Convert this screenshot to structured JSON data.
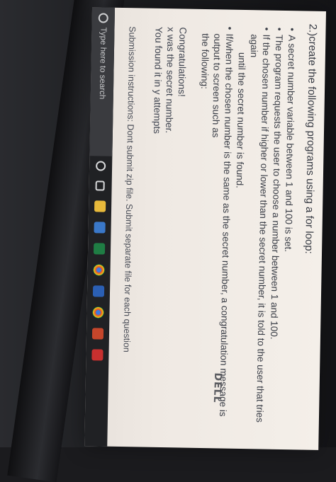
{
  "question": {
    "title": "2.)create the following programs using a for loop:",
    "bullets": [
      "A secret number variable between 1 and 100 is set.",
      "The program requests the user to choose a number between 1 and 100.",
      "If the chosen number if higher or lower than the secret number, it is told to the user that tries again",
      "until the secret number is found.",
      "If/when the chosen number is the same as the secret number, a congratulation message is output to screen such as",
      "the following:"
    ],
    "message_lines": [
      "Congratulations!",
      "x was the secret number.",
      "You found it in y attempts"
    ],
    "submission": "Submission instructions: Dont submit zip file. Submit separate file for each question"
  },
  "taskbar": {
    "search_placeholder": "Type here to search",
    "icons": [
      "cortana-icon",
      "task-view-icon",
      "file-explorer-icon",
      "store-icon",
      "excel-icon",
      "chrome-icon",
      "word-icon",
      "chrome-icon-2",
      "powerpoint-icon",
      "app-icon"
    ]
  },
  "hardware": {
    "brand": "DELL"
  }
}
